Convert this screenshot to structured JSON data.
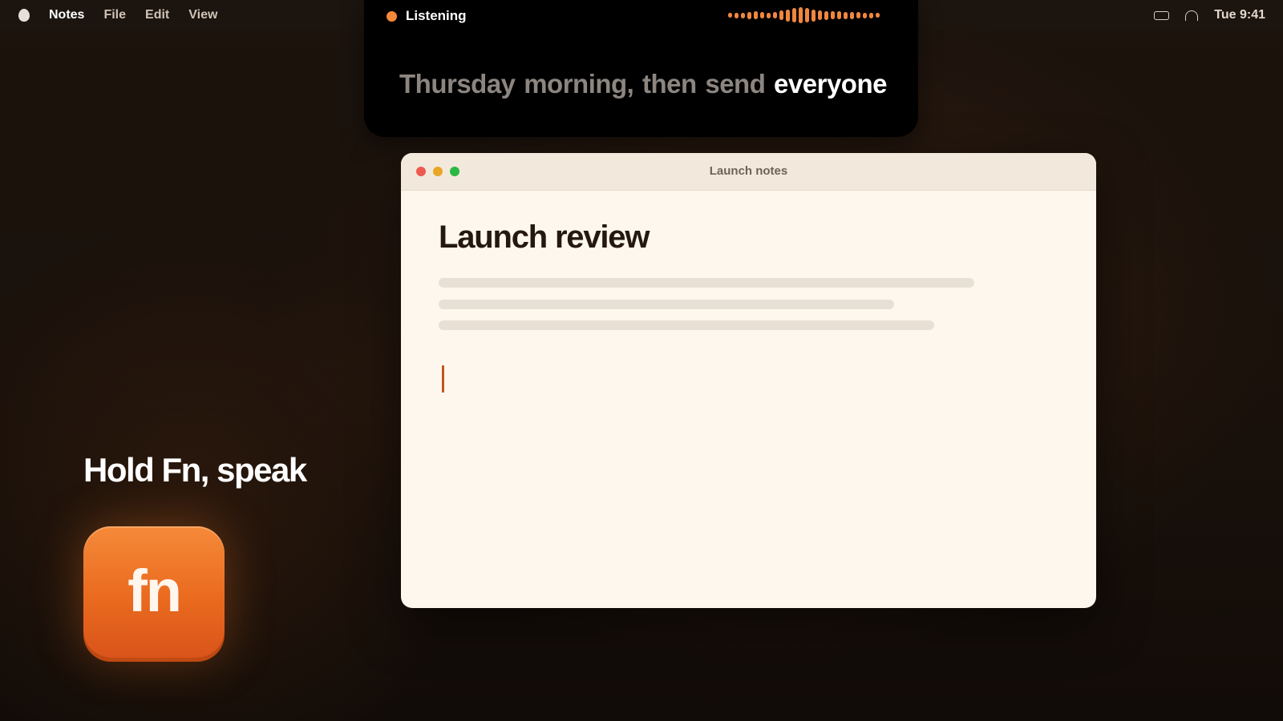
{
  "menubar": {
    "app_name": "Notes",
    "items": [
      "File",
      "Edit",
      "View"
    ],
    "clock": "Tue 9:41"
  },
  "dictation": {
    "status": "Listening",
    "transcript_faded": "Thursday morning, then send",
    "transcript_current": "everyone"
  },
  "window": {
    "title": "Launch notes",
    "note_title": "Launch review"
  },
  "hint": {
    "text": "Hold Fn, speak",
    "key_label": "fn"
  },
  "colors": {
    "accent": "#f0873e",
    "fn_key": "#ea6a1f",
    "cursor": "#c2541d",
    "window_bg": "#fdf7ed"
  },
  "icons": [
    "apple-logo-icon",
    "battery-icon",
    "headphones-icon",
    "recording-dot-icon",
    "waveform-icon"
  ]
}
